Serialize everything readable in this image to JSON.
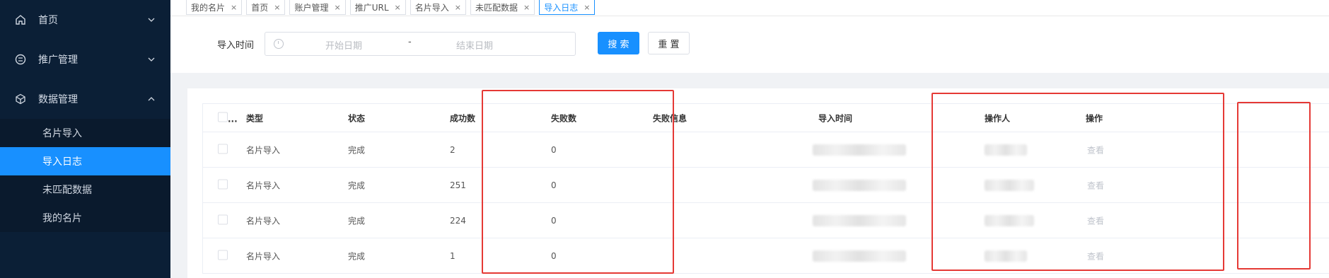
{
  "sidebar": {
    "groups": [
      {
        "label": "首页",
        "icon": "home-icon",
        "expanded": false
      },
      {
        "label": "推广管理",
        "icon": "promotion-icon",
        "expanded": false
      },
      {
        "label": "数据管理",
        "icon": "data-cube-icon",
        "expanded": true
      }
    ],
    "sub_items": [
      {
        "label": "名片导入",
        "active": false
      },
      {
        "label": "导入日志",
        "active": true
      },
      {
        "label": "未匹配数据",
        "active": false
      },
      {
        "label": "我的名片",
        "active": false
      }
    ]
  },
  "tabs": [
    {
      "label": "我的名片",
      "close": "×",
      "active": false
    },
    {
      "label": "首页",
      "close": "×",
      "active": false
    },
    {
      "label": "账户管理",
      "close": "×",
      "active": false
    },
    {
      "label": "推广URL",
      "close": "×",
      "active": false
    },
    {
      "label": "名片导入",
      "close": "×",
      "active": false
    },
    {
      "label": "未匹配数据",
      "close": "×",
      "active": false
    },
    {
      "label": "导入日志",
      "close": "×",
      "active": true
    }
  ],
  "search": {
    "label": "导入时间",
    "start_placeholder": "开始日期",
    "separator": "-",
    "end_placeholder": "结束日期",
    "search_button": "搜 索",
    "reset_button": "重 置"
  },
  "table": {
    "select_all_ellipsis": "...",
    "columns": [
      "类型",
      "状态",
      "成功数",
      "失败数",
      "失败信息",
      "导入时间",
      "操作人",
      "操作"
    ],
    "rows": [
      {
        "type": "名片导入",
        "status": "完成",
        "success": "2",
        "fail": "0",
        "fail_info": "",
        "action": "查看"
      },
      {
        "type": "名片导入",
        "status": "完成",
        "success": "251",
        "fail": "0",
        "fail_info": "",
        "action": "查看"
      },
      {
        "type": "名片导入",
        "status": "完成",
        "success": "224",
        "fail": "0",
        "fail_info": "",
        "action": "查看"
      },
      {
        "type": "名片导入",
        "status": "完成",
        "success": "1",
        "fail": "0",
        "fail_info": "",
        "action": "查看"
      }
    ]
  },
  "colors": {
    "sidebar_bg": "#0b1f36",
    "accent": "#1890ff",
    "highlight_box": "#e53935"
  }
}
